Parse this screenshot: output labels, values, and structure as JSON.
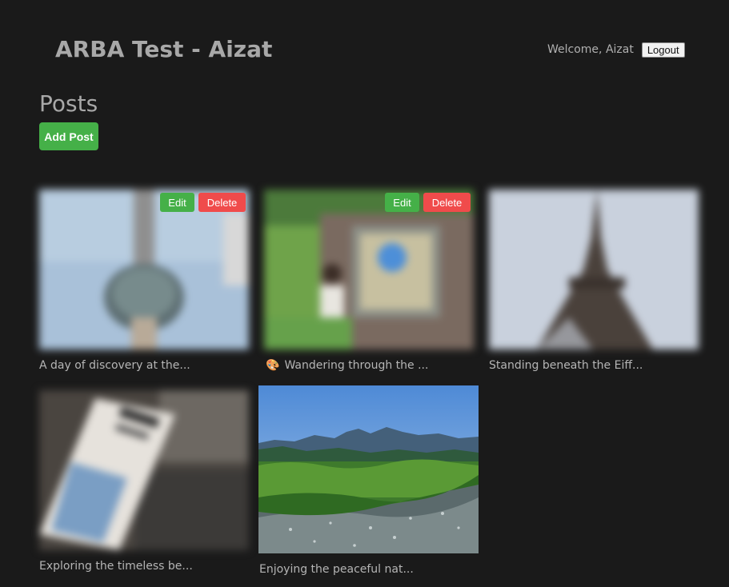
{
  "header": {
    "app_title": "ARBA Test - Aizat",
    "welcome_text": "Welcome, Aizat",
    "logout_label": "Logout"
  },
  "posts_section": {
    "title": "Posts",
    "add_post_label": "Add Post"
  },
  "posts": [
    {
      "caption": "A day of discovery at the...",
      "edit_label": "Edit",
      "delete_label": "Delete",
      "image": "tower-sky"
    },
    {
      "caption": "Wandering through the ...",
      "emoji": "🎨",
      "edit_label": "Edit",
      "delete_label": "Delete",
      "image": "person-wall-art"
    },
    {
      "caption": "Standing beneath the Eiff...",
      "image": "eiffel-tower"
    },
    {
      "caption": "Exploring the timeless be...",
      "image": "magazine"
    },
    {
      "caption": "Enjoying the peaceful nat...",
      "image": "river-mountain"
    }
  ]
}
